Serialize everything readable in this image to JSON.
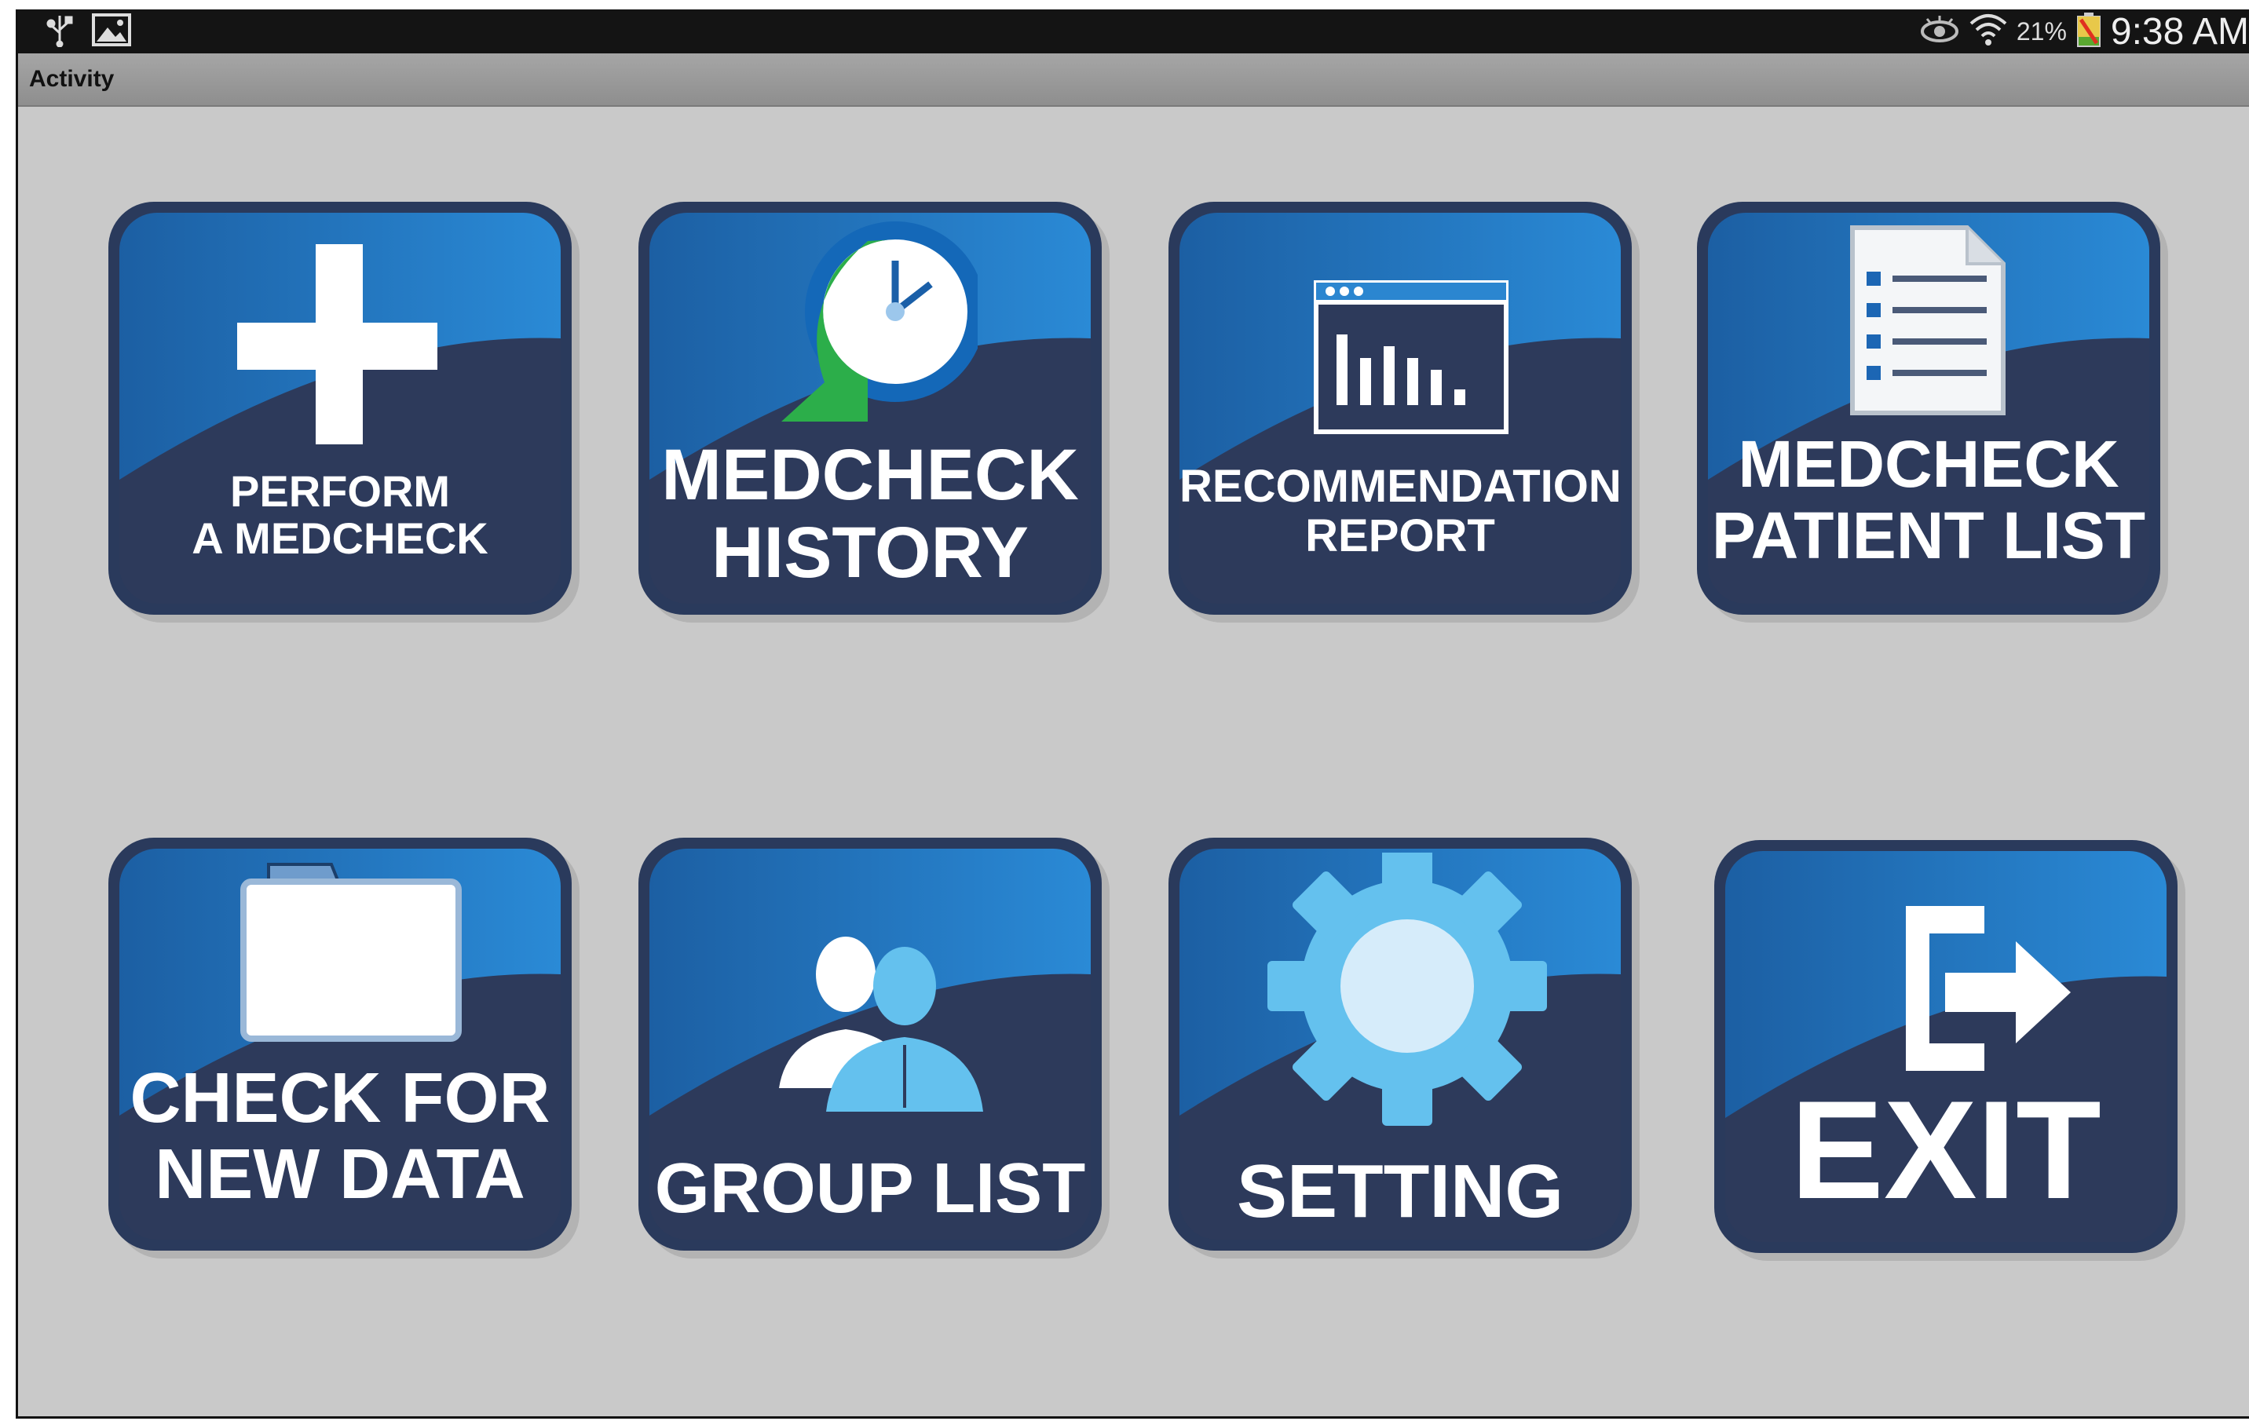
{
  "status_bar": {
    "battery_percent": "21%",
    "time": "9:38 AM",
    "left_icons": [
      "usb-icon",
      "image-icon"
    ],
    "right_icons": [
      "eye-icon",
      "wifi-icon",
      "battery-icon"
    ]
  },
  "title_bar": {
    "title": "Activity"
  },
  "colors": {
    "tile_dark": "#2d3a5b",
    "tile_light": "#1f7bc4",
    "background": "#c9c9c9"
  },
  "tiles": [
    {
      "line1": "PERFORM",
      "line2": "A MEDCHECK",
      "icon": "plus-icon"
    },
    {
      "line1": "MEDCHECK",
      "line2": "HISTORY",
      "icon": "history-clock-icon"
    },
    {
      "line1": "RECOMMENDATION",
      "line2": "REPORT",
      "icon": "report-chart-icon"
    },
    {
      "line1": "MEDCHECK",
      "line2": "PATIENT LIST",
      "icon": "document-list-icon"
    },
    {
      "line1": "CHECK FOR",
      "line2": "NEW DATA",
      "icon": "folder-icon"
    },
    {
      "line1": "GROUP LIST",
      "line2": "",
      "icon": "group-people-icon"
    },
    {
      "line1": "SETTING",
      "line2": "",
      "icon": "gear-icon"
    },
    {
      "line1": "EXIT",
      "line2": "",
      "icon": "exit-door-icon"
    }
  ]
}
